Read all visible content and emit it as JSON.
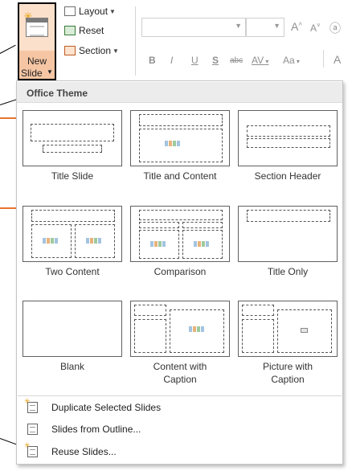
{
  "ribbon": {
    "new_slide_line1": "New",
    "new_slide_line2": "Slide",
    "layout_label": "Layout",
    "reset_label": "Reset",
    "section_label": "Section",
    "font_grow": "A",
    "font_shrink": "A",
    "bold": "B",
    "italic": "I",
    "underline": "U",
    "strike": "S",
    "abc": "abc",
    "spacing": "AV",
    "change_case": "Aa",
    "font_color": "A"
  },
  "gallery": {
    "title": "Office Theme",
    "layouts": [
      {
        "caption": "Title Slide"
      },
      {
        "caption": "Title and Content"
      },
      {
        "caption": "Section Header"
      },
      {
        "caption": "Two Content"
      },
      {
        "caption": "Comparison"
      },
      {
        "caption": "Title Only"
      },
      {
        "caption": "Blank"
      },
      {
        "caption": "Content with\nCaption"
      },
      {
        "caption": "Picture with\nCaption"
      }
    ],
    "menu": [
      {
        "label": "Duplicate Selected Slides",
        "icon": "duplicate-slide-icon"
      },
      {
        "label": "Slides from Outline...",
        "icon": "outline-icon"
      },
      {
        "label": "Reuse Slides...",
        "icon": "reuse-slides-icon"
      }
    ]
  },
  "colors": {
    "accent_orange": "#e8742e",
    "new_slide_highlight": "#f6c6a4"
  }
}
